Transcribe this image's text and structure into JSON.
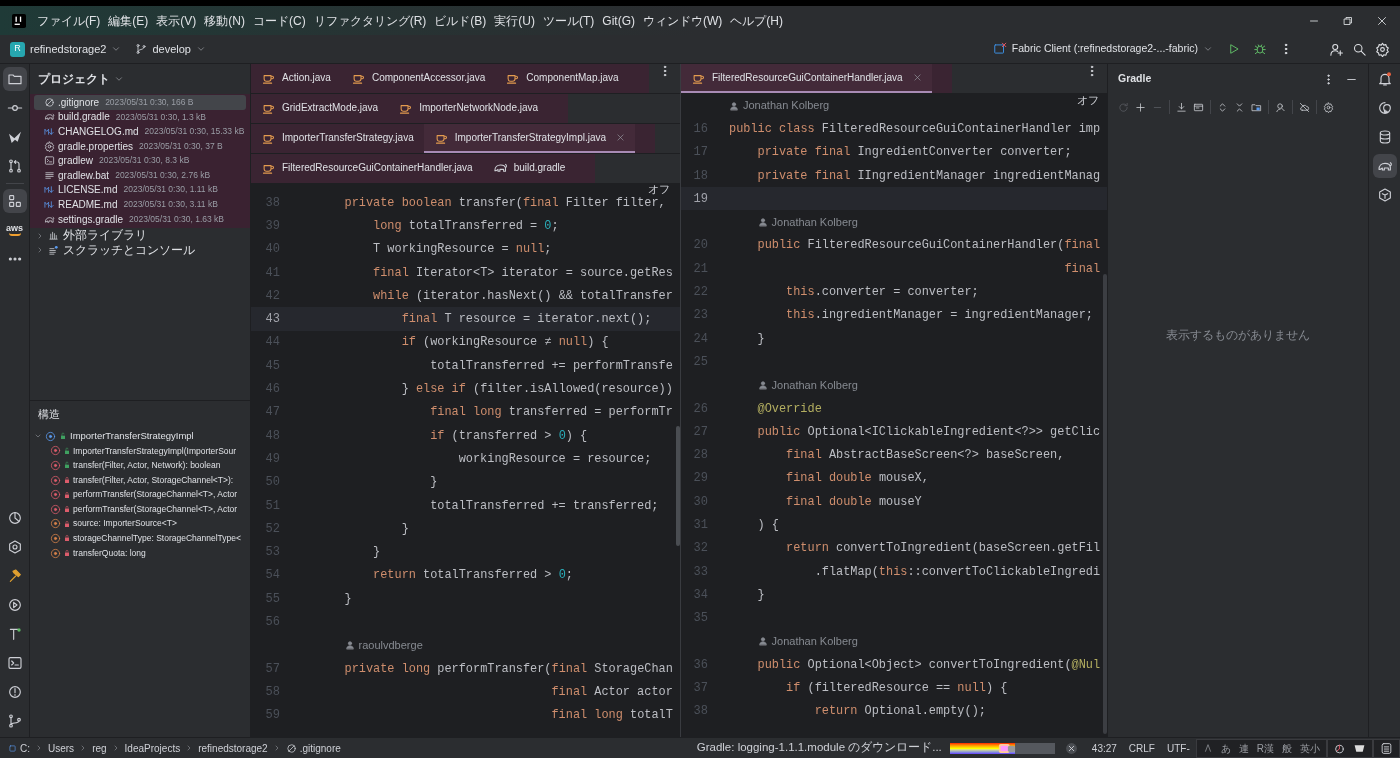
{
  "menu": [
    "ファイル(F)",
    "編集(E)",
    "表示(V)",
    "移動(N)",
    "コード(C)",
    "リファクタリング(R)",
    "ビルド(B)",
    "実行(U)",
    "ツール(T)",
    "Git(G)",
    "ウィンドウ(W)",
    "ヘルプ(H)"
  ],
  "toolbar": {
    "project_badge": "R",
    "project": "refinedstorage2",
    "branch": "develop",
    "run_config": "Fabric Client (:refinedstorage2-...-fabric)"
  },
  "left_toolbar": [
    {
      "kind": "folder",
      "selected": true
    },
    {
      "kind": "commit",
      "selected": false
    },
    {
      "kind": "swoosh",
      "selected": false
    },
    {
      "kind": "pull-requests",
      "selected": false
    },
    {
      "kind": "structure",
      "selected": true
    },
    {
      "kind": "aws",
      "label": "aws",
      "selected": false
    },
    {
      "kind": "more",
      "selected": false
    }
  ],
  "left_toolbar_bottom": [
    {
      "kind": "pie",
      "selected": false
    },
    {
      "kind": "services",
      "selected": false
    },
    {
      "kind": "hammer",
      "selected": false
    },
    {
      "kind": "run",
      "selected": false
    },
    {
      "kind": "build-tool",
      "selected": false
    },
    {
      "kind": "terminal",
      "selected": false
    },
    {
      "kind": "problems",
      "selected": false
    },
    {
      "kind": "git",
      "selected": false
    }
  ],
  "project": {
    "title": "プロジェクト",
    "items": [
      {
        "kind": "ignore",
        "name": ".gitignore",
        "meta": "2023/05/31 0:30, 166 B",
        "selected": true
      },
      {
        "kind": "gradle",
        "name": "build.gradle",
        "meta": "2023/05/31 0:30, 1.3 kB",
        "selected": false
      },
      {
        "kind": "markdown",
        "name": "CHANGELOG.md",
        "meta": "2023/05/31 0:30, 15.33 kB",
        "selected": false
      },
      {
        "kind": "settings",
        "name": "gradle.properties",
        "meta": "2023/05/31 0:30, 37 B",
        "selected": false
      },
      {
        "kind": "terminal",
        "name": "gradlew",
        "meta": "2023/05/31 0:30, 8.3 kB",
        "selected": false
      },
      {
        "kind": "text",
        "name": "gradlew.bat",
        "meta": "2023/05/31 0:30, 2.76 kB",
        "selected": false
      },
      {
        "kind": "markdown",
        "name": "LICENSE.md",
        "meta": "2023/05/31 0:30, 1.11 kB",
        "selected": false
      },
      {
        "kind": "markdown",
        "name": "README.md",
        "meta": "2023/05/31 0:30, 3.11 kB",
        "selected": false
      },
      {
        "kind": "gradle",
        "name": "settings.gradle",
        "meta": "2023/05/31 0:30, 1.63 kB",
        "selected": false
      }
    ],
    "groups": [
      {
        "kind": "library",
        "name": "外部ライブラリ",
        "expanded": false
      },
      {
        "kind": "scratch",
        "name": "スクラッチとコンソール",
        "expanded": false
      }
    ]
  },
  "structure": {
    "title": "構造",
    "root": {
      "kind": "class",
      "private": false,
      "name": "ImporterTransferStrategyImpl",
      "expanded": true,
      "children": [
        {
          "kind": "method",
          "private": false,
          "name": "ImporterTransferStrategyImpl(ImporterSour"
        },
        {
          "kind": "method",
          "private": false,
          "name": "transfer(Filter, Actor, Network): boolean"
        },
        {
          "kind": "method",
          "private": true,
          "name": "transfer(Filter, Actor, StorageChannel<T>):"
        },
        {
          "kind": "method",
          "private": true,
          "name": "performTransfer(StorageChannel<T>, Actor"
        },
        {
          "kind": "method",
          "private": true,
          "name": "performTransfer(StorageChannel<T>, Actor"
        },
        {
          "kind": "field",
          "private": true,
          "name": "source: ImporterSource<T>"
        },
        {
          "kind": "field",
          "private": true,
          "name": "storageChannelType: StorageChannelType<"
        },
        {
          "kind": "field",
          "private": true,
          "name": "transferQuota: long"
        }
      ]
    }
  },
  "left_editor": {
    "tab_rows": [
      [
        {
          "kind": "java",
          "name": "Action.java",
          "selected": false
        },
        {
          "kind": "java",
          "name": "ComponentAccessor.java",
          "selected": false
        },
        {
          "kind": "java",
          "name": "ComponentMap.java",
          "selected": false
        }
      ],
      [
        {
          "kind": "java",
          "name": "GridExtractMode.java",
          "selected": false
        },
        {
          "kind": "java",
          "name": "ImporterNetworkNode.java",
          "selected": false
        }
      ],
      [
        {
          "kind": "java",
          "name": "ImporterTransferStrategy.java",
          "selected": false
        },
        {
          "kind": "java",
          "name": "ImporterTransferStrategyImpl.java",
          "selected": true
        }
      ],
      [
        {
          "kind": "java",
          "name": "FilteredResourceGuiContainerHandler.java",
          "selected": false
        },
        {
          "kind": "gradle",
          "name": "build.gradle",
          "selected": false
        }
      ]
    ],
    "inlay_toggle": "オフ",
    "lines": [
      {
        "kind": "code",
        "number": "38",
        "text": "    private boolean transfer(final Filter filter,",
        "current": false
      },
      {
        "kind": "code",
        "number": "39",
        "text": "        long totalTransferred = 0;",
        "current": false
      },
      {
        "kind": "code",
        "number": "40",
        "text": "        T workingResource = null;",
        "current": false
      },
      {
        "kind": "code",
        "number": "41",
        "text": "        final Iterator<T> iterator = source.getRes",
        "current": false
      },
      {
        "kind": "code",
        "number": "42",
        "text": "        while (iterator.hasNext() && totalTransfer",
        "current": false
      },
      {
        "kind": "code",
        "number": "43",
        "text": "            final T resource = iterator.next();",
        "current": true
      },
      {
        "kind": "code",
        "number": "44",
        "text": "            if (workingResource ≠ null) {",
        "current": false
      },
      {
        "kind": "code",
        "number": "45",
        "text": "                totalTransferred += performTransfe",
        "current": false
      },
      {
        "kind": "code",
        "number": "46",
        "text": "            } else if (filter.isAllowed(resource))",
        "current": false
      },
      {
        "kind": "code",
        "number": "47",
        "text": "                final long transferred = performTr",
        "current": false
      },
      {
        "kind": "code",
        "number": "48",
        "text": "                if (transferred > 0) {",
        "current": false
      },
      {
        "kind": "code",
        "number": "49",
        "text": "                    workingResource = resource;",
        "current": false
      },
      {
        "kind": "code",
        "number": "50",
        "text": "                }",
        "current": false
      },
      {
        "kind": "code",
        "number": "51",
        "text": "                totalTransferred += transferred;",
        "current": false
      },
      {
        "kind": "code",
        "number": "52",
        "text": "            }",
        "current": false
      },
      {
        "kind": "code",
        "number": "53",
        "text": "        }",
        "current": false
      },
      {
        "kind": "code",
        "number": "54",
        "text": "        return totalTransferred > 0;",
        "current": false
      },
      {
        "kind": "code",
        "number": "55",
        "text": "    }",
        "current": false
      },
      {
        "kind": "code",
        "number": "56",
        "current": false
      },
      {
        "kind": "author",
        "text": "raoulvdberge"
      },
      {
        "kind": "code",
        "number": "57",
        "text": "    private long performTransfer(final StorageChan",
        "current": false
      },
      {
        "kind": "code",
        "number": "58",
        "text": "                                 final Actor actor",
        "current": false
      },
      {
        "kind": "code",
        "number": "59",
        "text": "                                 final long totalT",
        "current": false
      }
    ]
  },
  "right_editor": {
    "tab_rows": [
      [
        {
          "kind": "java",
          "name": "FilteredResourceGuiContainerHandler.java",
          "selected": true
        }
      ]
    ],
    "inlay_toggle": "オフ",
    "lines": [
      {
        "kind": "author",
        "text": "Jonathan Kolberg"
      },
      {
        "kind": "code",
        "number": "16",
        "text": "public class FilteredResourceGuiContainerHandler imp",
        "current": false
      },
      {
        "kind": "code",
        "number": "17",
        "text": "    private final IngredientConverter converter;",
        "current": false
      },
      {
        "kind": "code",
        "number": "18",
        "text": "    private final IIngredientManager ingredientManag",
        "current": false
      },
      {
        "kind": "code",
        "number": "19",
        "current": true
      },
      {
        "kind": "author",
        "text": "Jonathan Kolberg"
      },
      {
        "kind": "code",
        "number": "20",
        "text": "    public FilteredResourceGuiContainerHandler(final",
        "current": false
      },
      {
        "kind": "code",
        "number": "21",
        "text": "                                               final",
        "current": false
      },
      {
        "kind": "code",
        "number": "22",
        "text": "        this.converter = converter;",
        "current": false
      },
      {
        "kind": "code",
        "number": "23",
        "text": "        this.ingredientManager = ingredientManager;",
        "current": false
      },
      {
        "kind": "code",
        "number": "24",
        "text": "    }",
        "current": false
      },
      {
        "kind": "code",
        "number": "25",
        "current": false
      },
      {
        "kind": "author",
        "text": "Jonathan Kolberg"
      },
      {
        "kind": "code",
        "number": "26",
        "text": "    @Override",
        "current": false
      },
      {
        "kind": "code",
        "number": "27",
        "text": "    public Optional<IClickableIngredient<?>> getClic",
        "current": false
      },
      {
        "kind": "code",
        "number": "28",
        "text": "        final AbstractBaseScreen<?> baseScreen,",
        "current": false
      },
      {
        "kind": "code",
        "number": "29",
        "text": "        final double mouseX,",
        "current": false
      },
      {
        "kind": "code",
        "number": "30",
        "text": "        final double mouseY",
        "current": false
      },
      {
        "kind": "code",
        "number": "31",
        "text": "    ) {",
        "current": false
      },
      {
        "kind": "code",
        "number": "32",
        "text": "        return convertToIngredient(baseScreen.getFil",
        "current": false
      },
      {
        "kind": "code",
        "number": "33",
        "text": "            .flatMap(this::convertToClickableIngredi",
        "current": false
      },
      {
        "kind": "code",
        "number": "34",
        "text": "    }",
        "current": false
      },
      {
        "kind": "code",
        "number": "35",
        "current": false
      },
      {
        "kind": "author",
        "text": "Jonathan Kolberg"
      },
      {
        "kind": "code",
        "number": "36",
        "text": "    public Optional<Object> convertToIngredient(@Nul",
        "current": false
      },
      {
        "kind": "code",
        "number": "37",
        "text": "        if (filteredResource == null) {",
        "current": false
      },
      {
        "kind": "code",
        "number": "38",
        "text": "            return Optional.empty();",
        "current": false
      }
    ]
  },
  "gradle": {
    "title": "Gradle",
    "empty_text": "表示するものがありません"
  },
  "right_toolbar": [
    {
      "kind": "notifications",
      "selected": false
    },
    {
      "kind": "swirl",
      "selected": false
    },
    {
      "kind": "database",
      "selected": false
    },
    {
      "kind": "elephant",
      "selected": true
    },
    {
      "kind": "hexagon",
      "selected": false
    }
  ],
  "status_bar": {
    "breadcrumbs": [
      "C:",
      "Users",
      "reg",
      "IdeaProjects",
      "refinedstorage2",
      ".gitignore"
    ],
    "task": "Gradle: logging-1.1.1.module のダウンロード...",
    "progress": {
      "level": 0.62
    },
    "position": "43:27",
    "line_separator": "CRLF",
    "encoding": "UTF-",
    "ime": [
      "あ",
      "連",
      "R漢",
      "般",
      "英小"
    ]
  }
}
